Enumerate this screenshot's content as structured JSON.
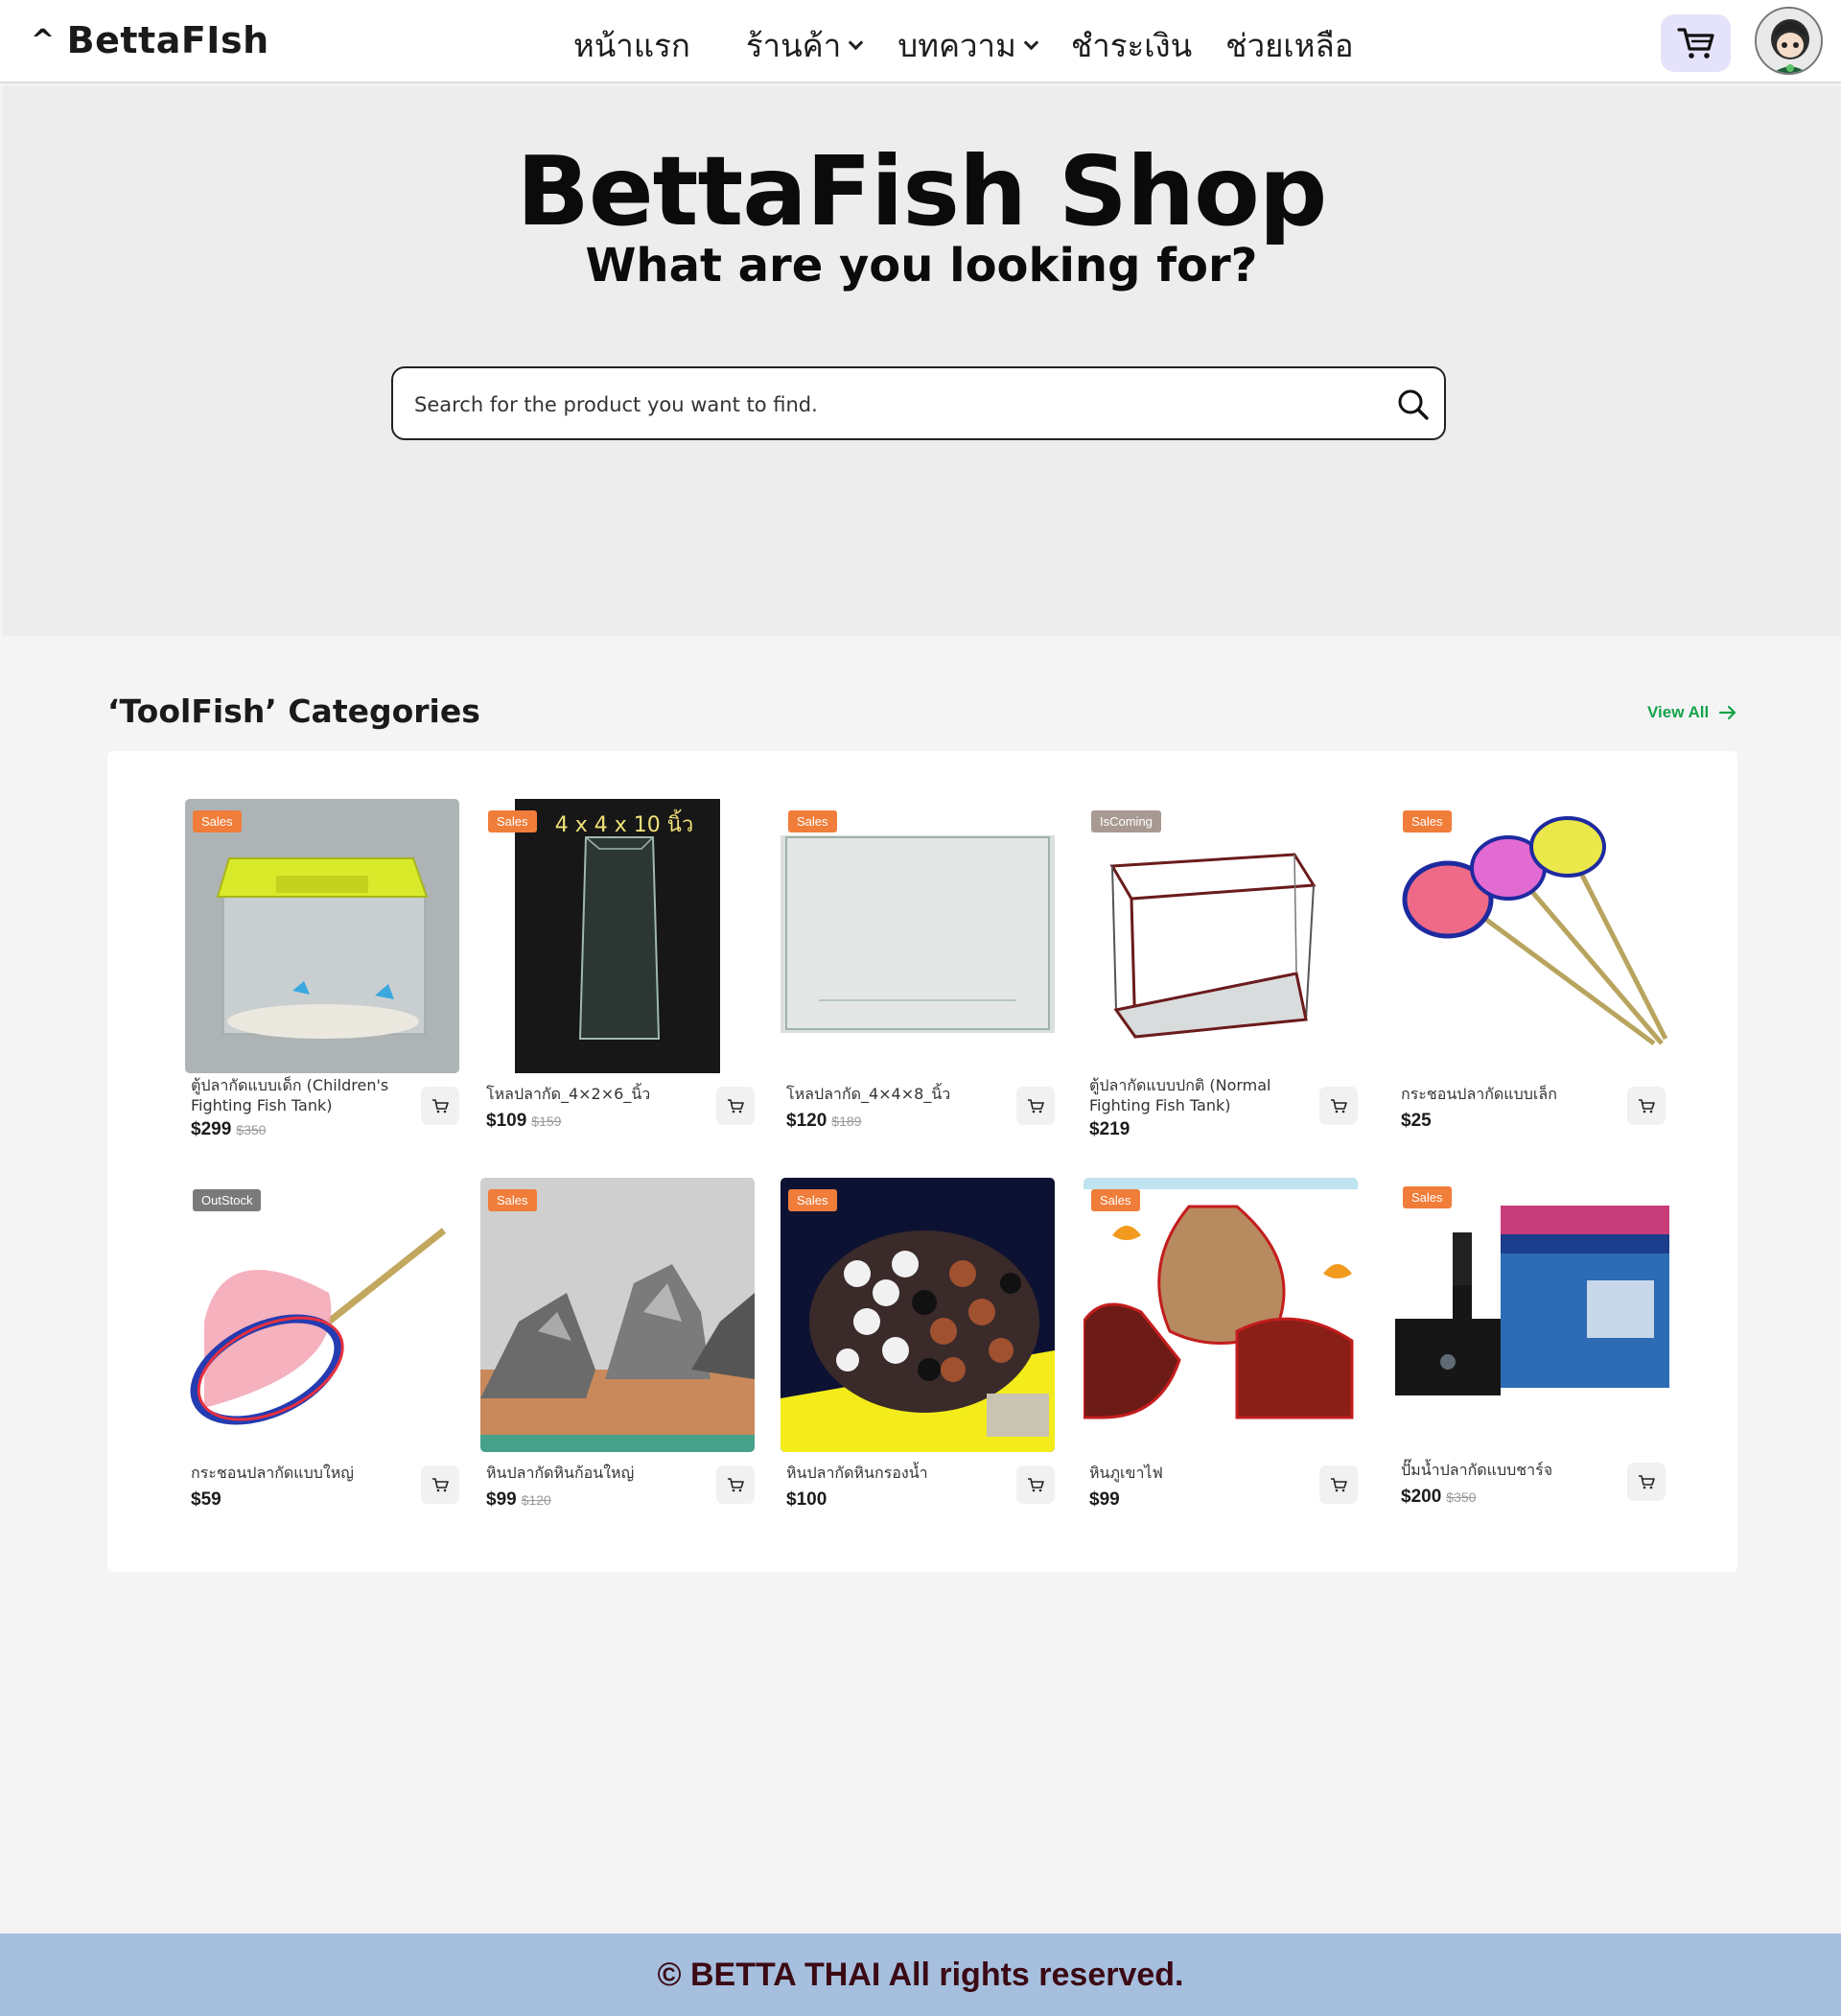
{
  "brand": {
    "caret": "^",
    "name": "BettaFIsh"
  },
  "nav": [
    {
      "label": "หน้าแรก",
      "dropdown": false
    },
    {
      "label": "ร้านค้า",
      "dropdown": true
    },
    {
      "label": "บทความ",
      "dropdown": true
    },
    {
      "label": "ชำระเงิน",
      "dropdown": false
    },
    {
      "label": "ช่วยเหลือ",
      "dropdown": false
    }
  ],
  "header_icons": {
    "cart": "cart-icon",
    "avatar": "user-avatar"
  },
  "hero": {
    "title": "BettaFish Shop",
    "subtitle": "What are you looking for?",
    "search_placeholder": "Search for the product you want to find.",
    "search_icon": "search-icon"
  },
  "categories": {
    "title": "‘ToolFish’ Categories",
    "view_all": "View All",
    "products": [
      {
        "badge": "Sales",
        "name": "ตู้ปลากัดแบบเด็ก (Children's Fighting Fish Tank)",
        "price": "$299",
        "old_price": "$350",
        "image": "plastic-tank"
      },
      {
        "badge": "Sales",
        "name": "โหลปลากัด_4×2×6_นิ้ว",
        "price": "$109",
        "old_price": "$159",
        "image": "tall-jar",
        "image_caption": "4 x 4 x 10 นิ้ว"
      },
      {
        "badge": "Sales",
        "name": "โหลปลากัด_4×4×8_นิ้ว",
        "price": "$120",
        "old_price": "$189",
        "image": "glass-tank"
      },
      {
        "badge": "IsComing",
        "name": "ตู้ปลากัดแบบปกติ (Normal Fighting Fish Tank)",
        "price": "$219",
        "old_price": "",
        "image": "frame-tank"
      },
      {
        "badge": "Sales",
        "name": "กระชอนปลากัดแบบเล็ก",
        "price": "$25",
        "old_price": "",
        "image": "small-nets"
      },
      {
        "badge": "OutStock",
        "name": "กระชอนปลากัดแบบใหญ่",
        "price": "$59",
        "old_price": "",
        "image": "big-net"
      },
      {
        "badge": "Sales",
        "name": "หินปลากัดหินก้อนใหญ่",
        "price": "$99",
        "old_price": "$120",
        "image": "rocks"
      },
      {
        "badge": "Sales",
        "name": "หินปลากัดหินกรองน้ำ",
        "price": "$100",
        "old_price": "",
        "image": "filter-media"
      },
      {
        "badge": "Sales",
        "name": "หินภูเขาไฟ",
        "price": "$99",
        "old_price": "",
        "image": "lava-rock"
      },
      {
        "badge": "Sales",
        "name": "ปั๊มน้ำปลากัดแบบชาร์จ",
        "price": "$200",
        "old_price": "$350",
        "image": "water-pump"
      }
    ]
  },
  "footer": {
    "text": "© BETTA THAI All rights reserved."
  }
}
